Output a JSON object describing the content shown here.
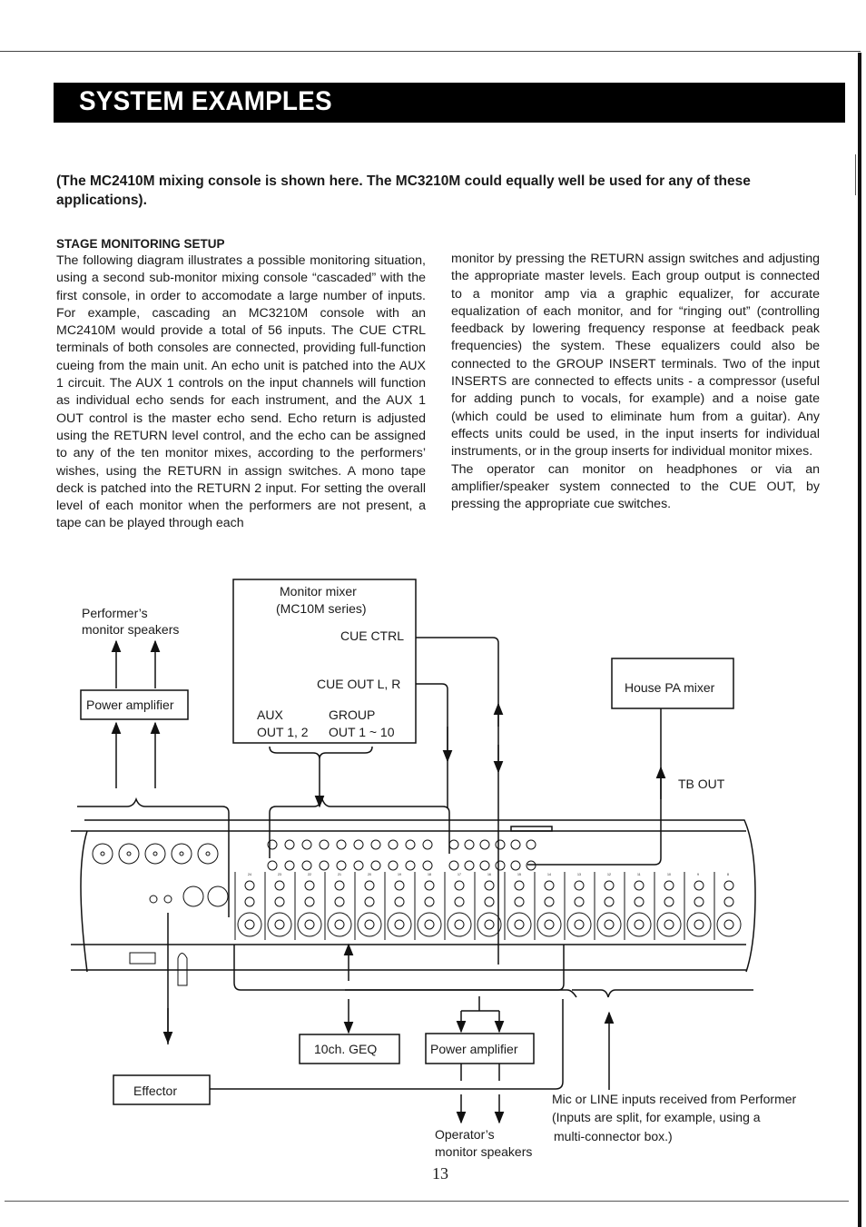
{
  "header": {
    "title": "SYSTEM EXAMPLES"
  },
  "intro": "(The MC2410M mixing console is shown here. The MC3210M could equally well be used for any of these applications).",
  "section": {
    "heading": "STAGE MONITORING SETUP",
    "left_paragraph": "The following diagram illustrates a possible monitoring situation, using a second sub-monitor mixing console “cascaded” with the first console, in order to accomodate a large number of inputs. For example, cascading an MC3210M console with an MC2410M would provide a total of 56 inputs. The CUE CTRL terminals of both consoles are connected, providing full-function cueing from the main unit. An echo unit is patched into the AUX 1 circuit. The AUX 1 controls on the input channels will function as individual echo sends for each instrument, and the AUX 1 OUT control is the master echo send. Echo return is adjusted using the RETURN level control, and the echo can be assigned to any of the ten monitor mixes, according to the performers’ wishes, using the RETURN in assign switches. A mono tape deck is patched into the RETURN 2 input. For setting the overall level of each monitor when the performers are not present, a tape can be played through each",
    "right_paragraph_1": "monitor by pressing the RETURN assign switches and adjusting the appropriate master levels. Each group output is connected to a monitor amp via a graphic equalizer, for accurate equalization of each monitor, and for “ringing out” (controlling feedback by lowering frequency response at feedback peak frequencies) the system. These equalizers could also be connected to the GROUP INSERT terminals. Two of the input INSERTS are connected to effects units - a compressor (useful for adding punch to vocals, for example) and a noise gate (which could be used to eliminate hum from a guitar). Any effects units could be used, in the input inserts for individual instruments, or in the group inserts for individual monitor mixes.",
    "right_paragraph_2": "The operator can monitor on headphones or via an amplifier/speaker system connected to the CUE OUT, by pressing the appropriate cue switches."
  },
  "diagram": {
    "performer_speakers": [
      "Performer’s",
      "monitor speakers"
    ],
    "power_amp_top": "Power amplifier",
    "monitor_mixer": {
      "line1": "Monitor mixer",
      "line2": "(MC10M series)",
      "cue_ctrl": "CUE CTRL",
      "cue_out": "CUE OUT L, R",
      "aux": "AUX",
      "aux_out": "OUT 1, 2",
      "group": "GROUP",
      "group_out": "OUT 1 ~ 10"
    },
    "house_pa": "House PA mixer",
    "tb_out": "TB OUT",
    "geq": "10ch. GEQ",
    "power_amp_bottom": "Power amplifier",
    "effector": "Effector",
    "operator_speakers": [
      "Operator’s",
      "monitor speakers"
    ],
    "inputs_note": [
      "Mic or LINE inputs received from Performer",
      "(Inputs are split, for example, using a",
      "multi-connector box.)"
    ],
    "console_channels": [
      "24",
      "23",
      "22",
      "21",
      "20",
      "19",
      "18",
      "17",
      "16",
      "15",
      "14",
      "13",
      "12",
      "11",
      "10",
      "9",
      "8"
    ]
  },
  "footer": {
    "page_number": "13"
  }
}
